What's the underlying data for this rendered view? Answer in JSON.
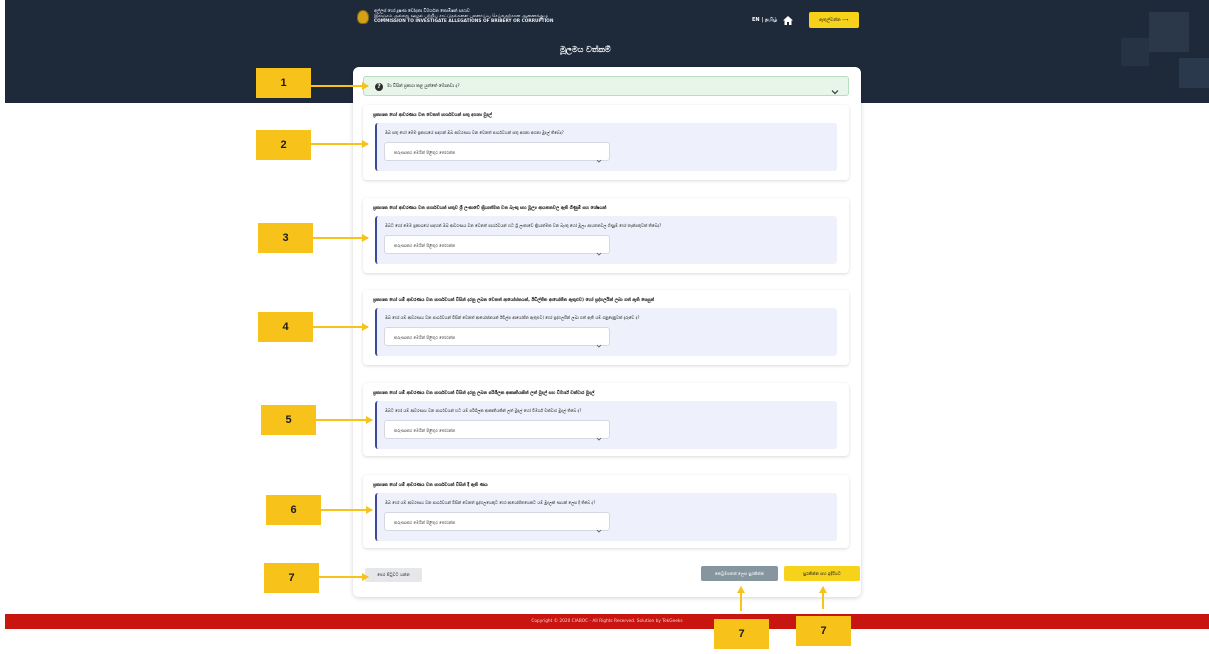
{
  "header": {
    "org_line1": "අල්ලස් හෝ දූෂණ චෝදනා විමර්ශන කොමිෂන් සභාව",
    "org_line2": "இலஞ்சம் அல்லது ஊழல் பற்றிய சாட்டுதல்களை புலனாய்வு செய்வதற்கான ஆணைக்குழு",
    "org_line3": "COMMISSION TO INVESTIGATE ALLEGATIONS OF BRIBERY OR CORRUPTION",
    "lang_switch": "EN | தமிழ்",
    "login_button": "ඇතුල්වන්න ⟶",
    "page_title": "මූලමය වත්කම්"
  },
  "info_bar": {
    "text": "මා විසින් ප්‍රකාශ කළ යුත්තේ මොනවා ද?"
  },
  "sections": [
    {
      "title": "ප්‍රකාශක හෝ ආවරණය වන වෙනත් පාර්ශවයන් සතු අගනා මුදල්",
      "question": "ඔබ සතු හෝ මෙම ප්‍රකාශයේ සඳහන් ඔබ ආවරණය වන වෙනත් පාර්ශවයන් සතු අගනා අගනා මුදල් තිබේද?",
      "select_value": "කරුණාකර මෙයින් පිළිතුර තෝරන්න"
    },
    {
      "title": "ප්‍රකාශක හෝ ආවරණය වන පාර්ශවයන් සතුව ශ්‍රී ලංකාවේ ක්‍රියාත්මක වන බැංකු සහ මූල්‍ය ආයතනවල ඇති ගිණුම් සහ ශේෂයන්",
      "question": "ඔබට හෝ මෙම ප්‍රකාශයේ සඳහන් ඔබ ආවරණය වන වෙනත් පාර්ශවයන් හට ශ්‍රී ලංකාවේ ක්‍රියාත්මක වන බැංකු හෝ මූල්‍ය ආයතනවල ගිණුම් හෝ තැන්පතුවක් තිබේද?",
      "select_value": "කරුණාකර මෙයින් පිළිතුර තෝරන්න"
    },
    {
      "title": "ප්‍රකාශක හෝ යම් ආවරණය වන පාර්ශවයන් විසින් දරනු ලබන වෙනත් ආයෝජනයන්, ඊඩිල්ජිත ආයෝජිත ඇතුළුව) හෝ ප්‍රද්ගලයින් ලබා ගත් ඇති සෙසුන්",
      "question": "ඔබ හෝ යම් ආවරණය වන පාර්ශවයන් විසින් වෙනත් ආයෝජනයන් ඊඩිල්ප ආයෝජිත ඇතුළුව) හෝ ප්‍රද්ගලයින් ලබා ගත් ඇති යම් ගනුදෙනුවක් දැරුවේ ද?",
      "select_value": "කරුණාකර මෙයින් පිළිතුර තෝරන්න"
    },
    {
      "title": "ප්‍රකාශක හෝ යම් ආවරණය වන පාර්ශවයන් විසින් දරනු ලබන පරිශීලක ආකෘතියකින් ලත් මුදල් සහ විමර්ශ් චක්වාර මුදල්",
      "question": "ඔබට හෝ යම් ආවරණය වන පාර්ශවයන් හට යම් පරිශීලක ආකෘතියකින් ලත් මුදල් හෝ විමර්ශ් චක්වාර මුදල් තිබේ ද?",
      "select_value": "කරුණාකර මෙයින් පිළිතුර තෝරන්න"
    },
    {
      "title": "ප්‍රකාශක හෝ යම් ආවරණය වන පාර්ශවයන් විසින් දී ඇති ණය",
      "question": "ඔබ හෝ යම් ආවරණය වන පාර්ශවයන් විසින් වෙනත් ප්‍රද්ගලයෙකුට හෝ ආයෝජිතයෙකට යම් මුදලක් ණයක් ලෙස දී තිබේ ද?",
      "select_value": "කරුණාකර මෙයින් පිළිතුර තෝරන්න"
    }
  ],
  "buttons": {
    "back": "පෙර පිටුවට යන්න",
    "save_draft": "කෙටුම්පතක් ලෙස සුරකින්න",
    "save_next": "සුරකින්න සහ ඉදිරියට"
  },
  "footer": {
    "copyright": "Copyright © 2020 CIABOC - All Rights Reserved. Solution by TekGeeks"
  },
  "callouts": [
    "1",
    "2",
    "3",
    "4",
    "5",
    "6",
    "7",
    "7",
    "7"
  ],
  "colors": {
    "header_bg": "#1e2a3a",
    "accent_yellow": "#f6d21b",
    "footer_red": "#c8150f",
    "info_green": "#e8f6ea",
    "callout_yellow": "#f7c31b",
    "section_accent": "#3b4a9c"
  }
}
